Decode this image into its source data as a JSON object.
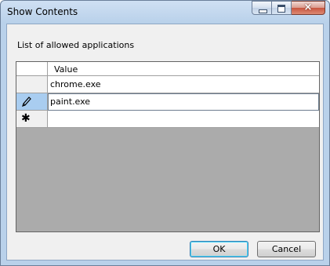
{
  "window": {
    "title": "Show Contents",
    "caption_buttons": [
      "minimize-icon",
      "maximize-icon",
      "close-icon"
    ],
    "close_glyph": "×"
  },
  "dialog": {
    "list_label": "List of allowed applications",
    "grid": {
      "column_header": "Value",
      "rows": [
        {
          "value": "chrome.exe",
          "state": "normal"
        },
        {
          "value": "paint.exe",
          "state": "editing",
          "indicator_icon": "pencil-icon"
        },
        {
          "value": "",
          "state": "new-row",
          "indicator_icon": "asterisk-icon"
        }
      ],
      "new_row_glyph": "✱"
    },
    "buttons": {
      "ok": "OK",
      "cancel": "Cancel"
    }
  },
  "colors": {
    "title_gradient_top": "#cfe0f3",
    "client_bg": "#f0f0f0",
    "grid_bg": "#ababab",
    "selected_row_header": "#a9cdf0",
    "default_button_border": "#3c7fb1"
  }
}
